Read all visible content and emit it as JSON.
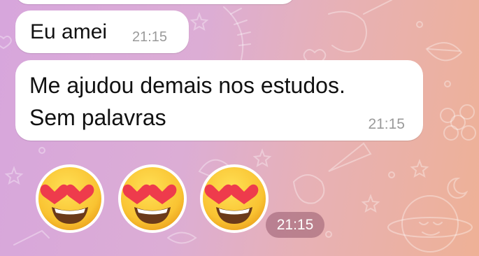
{
  "chat": {
    "background_colors": [
      "#d7a6dc",
      "#eeb196"
    ],
    "messages": [
      {
        "text": "Eu amei",
        "time": "21:15"
      },
      {
        "lines": [
          "Me ajudou demais nos estudos.",
          "Sem palavras"
        ],
        "time": "21:15"
      }
    ],
    "emoji_message": {
      "emojis": [
        "heart-eyes-icon",
        "heart-eyes-icon",
        "heart-eyes-icon"
      ],
      "time": "21:15"
    }
  }
}
